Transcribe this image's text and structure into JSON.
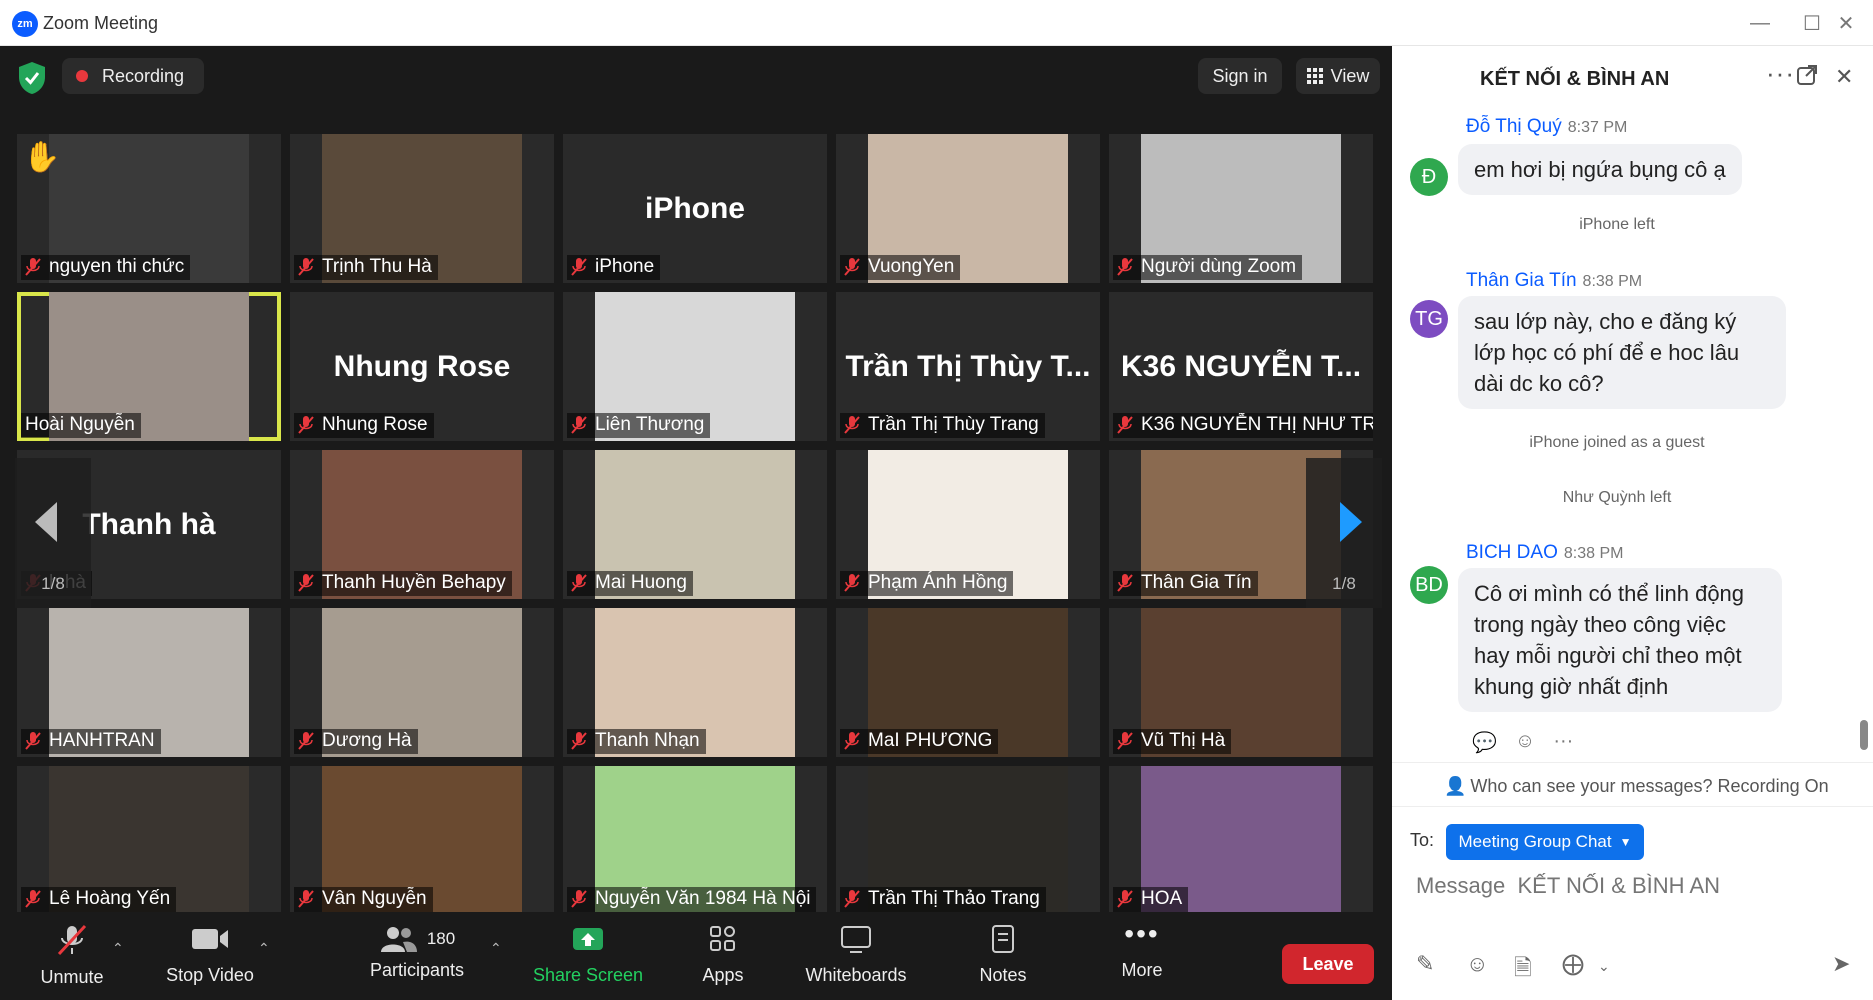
{
  "window": {
    "title": "Zoom Meeting",
    "logo": "zm"
  },
  "topbar": {
    "recording_label": "Recording",
    "signin_label": "Sign in",
    "view_label": "View"
  },
  "tiles": [
    {
      "label": "nguyen thi chức",
      "big": "",
      "muted": true,
      "bg": "#3a3a3a",
      "hand": true
    },
    {
      "label": "Trịnh Thu Hà",
      "big": "",
      "muted": true,
      "bg": "#5a4a3a"
    },
    {
      "label": "iPhone",
      "big": "iPhone",
      "muted": true,
      "bg": ""
    },
    {
      "label": "VuongYen",
      "big": "",
      "muted": true,
      "bg": "#c9b7a6"
    },
    {
      "label": "Người dùng Zoom",
      "big": "",
      "muted": true,
      "bg": "#bcbcbc"
    },
    {
      "label": "Hoài Nguyễn",
      "big": "",
      "muted": false,
      "bg": "#9a8f88",
      "active": true
    },
    {
      "label": "Nhung Rose",
      "big": "Nhung Rose",
      "muted": true,
      "bg": ""
    },
    {
      "label": "Liên Thương",
      "big": "",
      "muted": true,
      "bg": "#d8d8d8"
    },
    {
      "label": "Trần Thị Thùy Trang",
      "big": "Trần Thị Thùy T...",
      "muted": true,
      "bg": ""
    },
    {
      "label": "K36 NGUYỄN THỊ NHƯ TR...",
      "big": "K36 NGUYỄN T...",
      "muted": true,
      "bg": ""
    },
    {
      "label": "h hà",
      "big": "Thanh hà",
      "muted": true,
      "bg": ""
    },
    {
      "label": "Thanh Huyền Behapy",
      "big": "",
      "muted": true,
      "bg": "#7a5040"
    },
    {
      "label": "Mai Huong",
      "big": "",
      "muted": true,
      "bg": "#c9c3b0"
    },
    {
      "label": "Phạm Ánh Hồng",
      "big": "",
      "muted": true,
      "bg": "#f2ece4"
    },
    {
      "label": "Thân Gia Tín",
      "big": "",
      "muted": true,
      "bg": "#8a6a50"
    },
    {
      "label": "HANHTRAN",
      "big": "",
      "muted": true,
      "bg": "#b8b3ad"
    },
    {
      "label": "Dương Hà",
      "big": "",
      "muted": true,
      "bg": "#a69c90"
    },
    {
      "label": "Thanh Nhạn",
      "big": "",
      "muted": true,
      "bg": "#d9c4b0"
    },
    {
      "label": "MaI PHƯƠNG",
      "big": "",
      "muted": true,
      "bg": "#4a3828"
    },
    {
      "label": "Vũ Thị Hà",
      "big": "",
      "muted": true,
      "bg": "#5a4030"
    },
    {
      "label": "Lê Hoàng Yến",
      "big": "",
      "muted": true,
      "bg": "#3a3530"
    },
    {
      "label": "Vân Nguyễn",
      "big": "",
      "muted": true,
      "bg": "#6a4a30"
    },
    {
      "label": "Nguyễn Văn 1984 Hà Nội",
      "big": "",
      "muted": true,
      "bg": "#9fd28a"
    },
    {
      "label": "Trần Thị Thảo Trang",
      "big": "",
      "muted": true,
      "bg": "#2c2a26"
    },
    {
      "label": "HOA",
      "big": "",
      "muted": true,
      "bg": "#7a5a8a"
    }
  ],
  "pager": {
    "left_page": "1/8",
    "right_page": "1/8"
  },
  "toolbar": {
    "unmute": "Unmute",
    "stop_video": "Stop Video",
    "participants": "Participants",
    "participants_count": "180",
    "share_screen": "Share Screen",
    "apps": "Apps",
    "whiteboards": "Whiteboards",
    "notes": "Notes",
    "more": "More",
    "leave": "Leave"
  },
  "chat": {
    "title": "KẾT NỐI & BÌNH AN",
    "messages": [
      {
        "avatar": "Đ",
        "avatar_color": "#2fa84f",
        "sender": "Đỗ Thị Quý",
        "time": "8:37 PM",
        "text": "em hơi bị ngứa bụng cô ạ"
      },
      {
        "avatar": "TG",
        "avatar_color": "#7d4cc1",
        "sender": "Thân Gia Tín",
        "time": "8:38 PM",
        "text": "sau lớp này, cho e đăng ký lớp học có phí để e hoc lâu dài dc ko cô?"
      },
      {
        "avatar": "BD",
        "avatar_color": "#2fa84f",
        "sender": "BICH DAO",
        "time": "8:38 PM",
        "text": "Cô ơi mình có thể linh động trong ngày theo công việc hay mỗi người chỉ theo một khung giờ nhất định"
      }
    ],
    "system": [
      "iPhone left",
      "iPhone joined as a guest",
      "Như Quỳnh left"
    ],
    "who_can_see": "Who can see your messages? Recording On",
    "to_label": "To:",
    "to_value": "Meeting Group Chat",
    "placeholder": "Message  KẾT NỐI & BÌNH AN"
  }
}
